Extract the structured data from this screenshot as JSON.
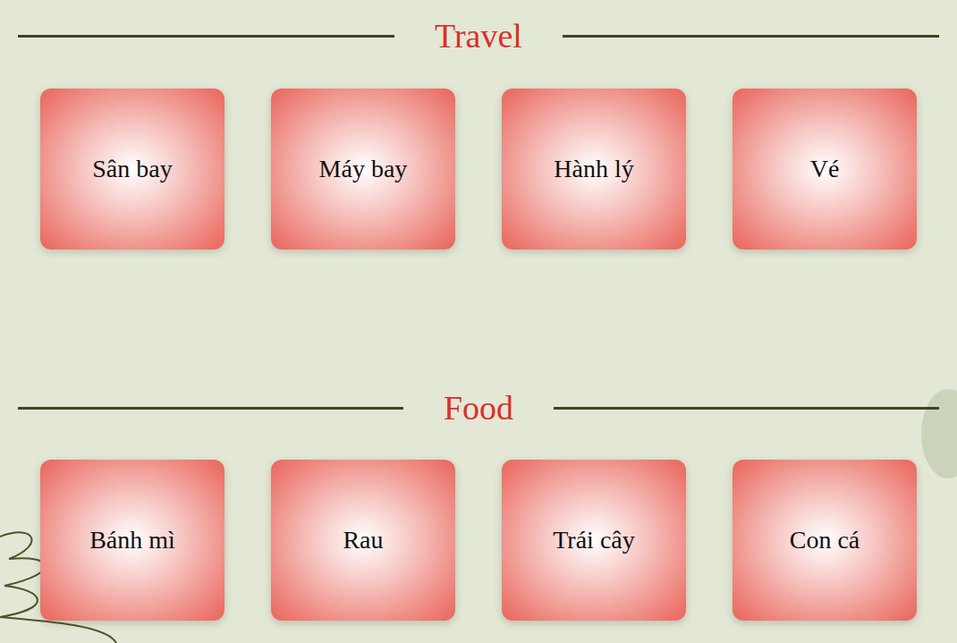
{
  "sections": [
    {
      "title": "Travel",
      "items": [
        "Sân bay",
        "Máy bay",
        "Hành lý",
        "Vé"
      ]
    },
    {
      "title": "Food",
      "items": [
        "Bánh mì",
        "Rau",
        "Trái cây",
        "Con cá"
      ]
    }
  ]
}
